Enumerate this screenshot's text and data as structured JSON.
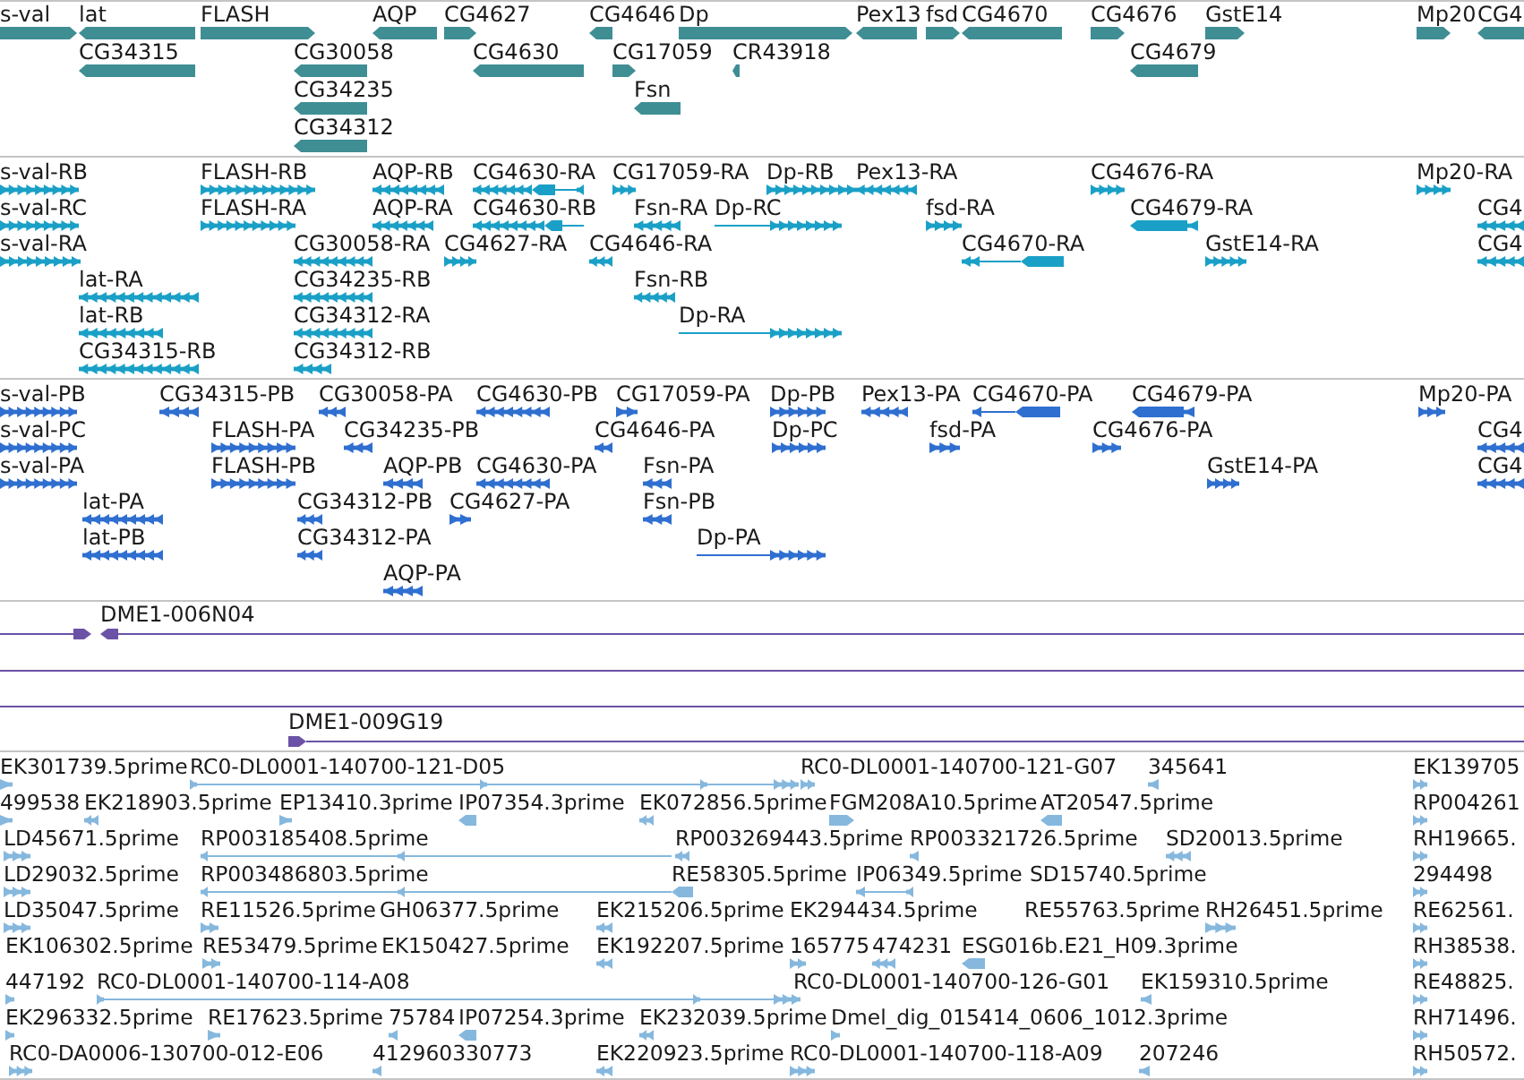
{
  "tracks": [
    {
      "kind": "gene",
      "rows": [
        {
          "features": [
            {
              "label": "s-val",
              "reverse": false
            },
            {
              "label": "lat",
              "reverse": true
            },
            {
              "label": "FLASH",
              "reverse": false
            },
            {
              "label": "AQP",
              "reverse": true
            },
            {
              "label": "CG4627",
              "reverse": false
            },
            {
              "label": "CG4646",
              "reverse": true
            },
            {
              "label": "Dp",
              "reverse": false
            },
            {
              "label": "Pex13",
              "reverse": true
            },
            {
              "label": "fsd",
              "reverse": false
            },
            {
              "label": "CG4670",
              "reverse": true
            },
            {
              "label": "CG4676",
              "reverse": false
            },
            {
              "label": "GstE14",
              "reverse": false
            },
            {
              "label": "Mp20",
              "reverse": false
            },
            {
              "label": "CG4",
              "reverse": true
            }
          ]
        },
        {
          "features": [
            {
              "label": "CG34315",
              "reverse": true
            },
            {
              "label": "CG30058",
              "reverse": true
            },
            {
              "label": "CG4630",
              "reverse": true
            },
            {
              "label": "CG17059",
              "reverse": false
            },
            {
              "label": "CR43918",
              "reverse": true
            },
            {
              "label": "CG4679",
              "reverse": true
            }
          ]
        },
        {
          "features": [
            {
              "label": "CG34235",
              "reverse": true
            },
            {
              "label": "Fsn",
              "reverse": true
            }
          ]
        },
        {
          "features": [
            {
              "label": "CG34312",
              "reverse": true
            }
          ]
        }
      ]
    },
    {
      "kind": "transcript",
      "rows": [
        {
          "features": [
            {
              "label": "s-val-RB",
              "reverse": false
            },
            {
              "label": "FLASH-RB",
              "reverse": false
            },
            {
              "label": "AQP-RB",
              "reverse": true
            },
            {
              "label": "CG4630-RA",
              "reverse": true
            },
            {
              "label": "CG17059-RA",
              "reverse": false
            },
            {
              "label": "Dp-RB",
              "reverse": false
            },
            {
              "label": "Pex13-RA",
              "reverse": true
            },
            {
              "label": "CG4676-RA",
              "reverse": false
            },
            {
              "label": "Mp20-RA",
              "reverse": false
            }
          ]
        },
        {
          "features": [
            {
              "label": "s-val-RC",
              "reverse": false
            },
            {
              "label": "FLASH-RA",
              "reverse": false
            },
            {
              "label": "AQP-RA",
              "reverse": true
            },
            {
              "label": "CG4630-RB",
              "reverse": true
            },
            {
              "label": "Fsn-RA",
              "reverse": true
            },
            {
              "label": "Dp-RC",
              "reverse": false
            },
            {
              "label": "fsd-RA",
              "reverse": false
            },
            {
              "label": "CG4679-RA",
              "reverse": true
            },
            {
              "label": "CG4",
              "reverse": true
            }
          ]
        },
        {
          "features": [
            {
              "label": "s-val-RA",
              "reverse": false
            },
            {
              "label": "CG30058-RA",
              "reverse": true
            },
            {
              "label": "CG4627-RA",
              "reverse": false
            },
            {
              "label": "CG4646-RA",
              "reverse": true
            },
            {
              "label": "CG4670-RA",
              "reverse": true
            },
            {
              "label": "GstE14-RA",
              "reverse": false
            },
            {
              "label": "CG4",
              "reverse": true
            }
          ]
        },
        {
          "features": [
            {
              "label": "lat-RA",
              "reverse": true
            },
            {
              "label": "CG34235-RB",
              "reverse": true
            },
            {
              "label": "Fsn-RB",
              "reverse": true
            }
          ]
        },
        {
          "features": [
            {
              "label": "lat-RB",
              "reverse": true
            },
            {
              "label": "CG34312-RA",
              "reverse": true
            },
            {
              "label": "Dp-RA",
              "reverse": false
            }
          ]
        },
        {
          "features": [
            {
              "label": "CG34315-RB",
              "reverse": true
            },
            {
              "label": "CG34312-RB",
              "reverse": true
            }
          ]
        }
      ]
    },
    {
      "kind": "protein",
      "rows": [
        {
          "features": [
            {
              "label": "s-val-PB",
              "reverse": false
            },
            {
              "label": "CG34315-PB",
              "reverse": true
            },
            {
              "label": "CG30058-PA",
              "reverse": true
            },
            {
              "label": "CG4630-PB",
              "reverse": true
            },
            {
              "label": "CG17059-PA",
              "reverse": false
            },
            {
              "label": "Dp-PB",
              "reverse": false
            },
            {
              "label": "Pex13-PA",
              "reverse": true
            },
            {
              "label": "CG4670-PA",
              "reverse": true
            },
            {
              "label": "CG4679-PA",
              "reverse": true
            },
            {
              "label": "Mp20-PA",
              "reverse": false
            }
          ]
        },
        {
          "features": [
            {
              "label": "s-val-PC",
              "reverse": false
            },
            {
              "label": "FLASH-PA",
              "reverse": false
            },
            {
              "label": "CG34235-PB",
              "reverse": true
            },
            {
              "label": "CG4646-PA",
              "reverse": true
            },
            {
              "label": "Dp-PC",
              "reverse": false
            },
            {
              "label": "fsd-PA",
              "reverse": false
            },
            {
              "label": "CG4676-PA",
              "reverse": false
            },
            {
              "label": "CG4",
              "reverse": true
            }
          ]
        },
        {
          "features": [
            {
              "label": "s-val-PA",
              "reverse": false
            },
            {
              "label": "FLASH-PB",
              "reverse": false
            },
            {
              "label": "AQP-PB",
              "reverse": true
            },
            {
              "label": "CG4630-PA",
              "reverse": true
            },
            {
              "label": "Fsn-PA",
              "reverse": true
            },
            {
              "label": "GstE14-PA",
              "reverse": false
            },
            {
              "label": "CG4",
              "reverse": true
            }
          ]
        },
        {
          "features": [
            {
              "label": "lat-PA",
              "reverse": true
            },
            {
              "label": "CG34312-PB",
              "reverse": true
            },
            {
              "label": "CG4627-PA",
              "reverse": false
            },
            {
              "label": "Fsn-PB",
              "reverse": true
            }
          ]
        },
        {
          "features": [
            {
              "label": "lat-PB",
              "reverse": true
            },
            {
              "label": "CG34312-PA",
              "reverse": true
            },
            {
              "label": "Dp-PA",
              "reverse": false
            }
          ]
        },
        {
          "features": [
            {
              "label": "AQP-PA",
              "reverse": true
            }
          ]
        }
      ]
    },
    {
      "kind": "clone",
      "rows": [
        {
          "features": [
            {
              "kind": "arrow",
              "reverse": false
            },
            {
              "label": "DME1-006N04",
              "kind": "arrow",
              "reverse": true
            }
          ]
        },
        {
          "features": [
            {
              "kind": "line"
            }
          ]
        },
        {
          "features": [
            {
              "kind": "line"
            }
          ]
        },
        {
          "features": [
            {
              "label": "DME1-009G19",
              "kind": "arrow",
              "reverse": false
            }
          ]
        }
      ]
    },
    {
      "kind": "est",
      "rows": [
        {
          "features": [
            {
              "label": "EK301739.5prime",
              "reverse": false
            },
            {
              "label": "RC0-DL0001-140700-121-D05",
              "reverse": false
            },
            {
              "label": "RC0-DL0001-140700-121-G07",
              "reverse": false
            },
            {
              "label": "345641",
              "reverse": true
            },
            {
              "label": "EK139705",
              "reverse": false
            }
          ]
        },
        {
          "features": [
            {
              "label": "499538",
              "reverse": false
            },
            {
              "label": "EK218903.5prime",
              "reverse": true
            },
            {
              "label": "EP13410.3prime",
              "reverse": false
            },
            {
              "label": "IP07354.3prime",
              "reverse": true
            },
            {
              "label": "EK072856.5prime",
              "reverse": true
            },
            {
              "label": "FGM208A10.5prime",
              "reverse": false
            },
            {
              "label": "AT20547.5prime",
              "reverse": true
            },
            {
              "label": "RP004261",
              "reverse": false
            }
          ]
        },
        {
          "features": [
            {
              "label": "LD45671.5prime",
              "reverse": false
            },
            {
              "label": "RP003185408.5prime",
              "reverse": true
            },
            {
              "label": "RP003269443.5prime",
              "reverse": true
            },
            {
              "label": "RP003321726.5prime",
              "reverse": true
            },
            {
              "label": "SD20013.5prime",
              "reverse": true
            },
            {
              "label": "RH19665.",
              "reverse": false
            }
          ]
        },
        {
          "features": [
            {
              "label": "LD29032.5prime",
              "reverse": false
            },
            {
              "label": "RP003486803.5prime",
              "reverse": true
            },
            {
              "label": "RE58305.5prime",
              "reverse": true
            },
            {
              "label": "IP06349.5prime",
              "reverse": true
            },
            {
              "label": "SD15740.5prime"
            },
            {
              "label": "294498",
              "reverse": false
            }
          ]
        },
        {
          "features": [
            {
              "label": "LD35047.5prime",
              "reverse": false
            },
            {
              "label": "RE11526.5prime",
              "reverse": false
            },
            {
              "label": "GH06377.5prime"
            },
            {
              "label": "EK215206.5prime",
              "reverse": true
            },
            {
              "label": "EK294434.5prime"
            },
            {
              "label": "RE55763.5prime"
            },
            {
              "label": "RH26451.5prime",
              "reverse": false
            },
            {
              "label": "RE62561.",
              "reverse": false
            }
          ]
        },
        {
          "features": [
            {
              "label": "EK106302.5prime"
            },
            {
              "label": "RE53479.5prime",
              "reverse": false
            },
            {
              "label": "EK150427.5prime"
            },
            {
              "label": "EK192207.5prime",
              "reverse": true
            },
            {
              "label": "165775",
              "reverse": false
            },
            {
              "label": "474231",
              "reverse": true
            },
            {
              "label": "ESG016b.E21_H09.3prime",
              "reverse": true
            },
            {
              "label": "RH38538.",
              "reverse": false
            }
          ]
        },
        {
          "features": [
            {
              "label": "447192",
              "reverse": false
            },
            {
              "label": "RC0-DL0001-140700-114-A08",
              "reverse": false
            },
            {
              "label": "RC0-DL0001-140700-126-G01"
            },
            {
              "label": "EK159310.5prime",
              "reverse": true
            },
            {
              "label": "RE48825.",
              "reverse": false
            }
          ]
        },
        {
          "features": [
            {
              "label": "EK296332.5prime",
              "reverse": false
            },
            {
              "label": "RE17623.5prime",
              "reverse": false
            },
            {
              "label": "75784",
              "reverse": true
            },
            {
              "label": "IP07254.3prime",
              "reverse": true
            },
            {
              "label": "EK232039.5prime",
              "reverse": true
            },
            {
              "label": "Dmel_dig_015414_0606_1012.3prime",
              "reverse": false
            },
            {
              "label": "RH71496.",
              "reverse": false
            }
          ]
        },
        {
          "features": [
            {
              "label": "RC0-DA0006-130700-012-E06",
              "reverse": false
            },
            {
              "label": "412960330773",
              "reverse": true
            },
            {
              "label": "EK220923.5prime",
              "reverse": true
            },
            {
              "label": "RC0-DL0001-140700-118-A09",
              "reverse": false
            },
            {
              "label": "207246",
              "reverse": true
            },
            {
              "label": "RH50572.",
              "reverse": false
            }
          ]
        }
      ]
    }
  ]
}
